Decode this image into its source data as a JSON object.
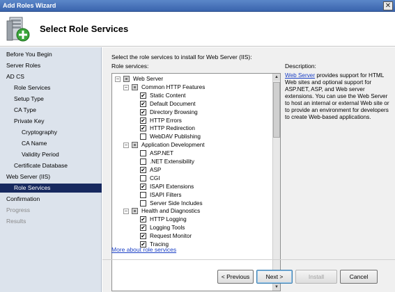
{
  "window": {
    "title": "Add Roles Wizard",
    "close_glyph": "✕"
  },
  "header": {
    "title": "Select Role Services",
    "icon": "server-add-icon"
  },
  "sidebar": {
    "items": [
      {
        "label": "Before You Begin",
        "level": 0,
        "state": "normal"
      },
      {
        "label": "Server Roles",
        "level": 0,
        "state": "normal"
      },
      {
        "label": "AD CS",
        "level": 0,
        "state": "normal"
      },
      {
        "label": "Role Services",
        "level": 1,
        "state": "normal"
      },
      {
        "label": "Setup Type",
        "level": 1,
        "state": "normal"
      },
      {
        "label": "CA Type",
        "level": 1,
        "state": "normal"
      },
      {
        "label": "Private Key",
        "level": 1,
        "state": "normal"
      },
      {
        "label": "Cryptography",
        "level": 2,
        "state": "normal"
      },
      {
        "label": "CA Name",
        "level": 2,
        "state": "normal"
      },
      {
        "label": "Validity Period",
        "level": 2,
        "state": "normal"
      },
      {
        "label": "Certificate Database",
        "level": 1,
        "state": "normal"
      },
      {
        "label": "Web Server (IIS)",
        "level": 0,
        "state": "normal"
      },
      {
        "label": "Role Services",
        "level": 1,
        "state": "selected"
      },
      {
        "label": "Confirmation",
        "level": 0,
        "state": "normal"
      },
      {
        "label": "Progress",
        "level": 0,
        "state": "disabled"
      },
      {
        "label": "Results",
        "level": 0,
        "state": "disabled"
      }
    ]
  },
  "main": {
    "instruction": "Select the role services to install for Web Server (IIS):",
    "role_services_label": "Role services:",
    "description_label": "Description:",
    "description_link": "Web Server",
    "description_text": " provides support for HTML Web sites and optional support for ASP.NET, ASP, and Web server extensions. You can use the Web Server to host an internal or external Web site or to provide an environment for developers to create Web-based applications.",
    "more_link": "More about role services",
    "tree": [
      {
        "label": "Web Server",
        "level": 0,
        "expander": "−",
        "check": "partial"
      },
      {
        "label": "Common HTTP Features",
        "level": 1,
        "expander": "−",
        "check": "partial"
      },
      {
        "label": "Static Content",
        "level": 2,
        "check": "checked"
      },
      {
        "label": "Default Document",
        "level": 2,
        "check": "checked"
      },
      {
        "label": "Directory Browsing",
        "level": 2,
        "check": "checked"
      },
      {
        "label": "HTTP Errors",
        "level": 2,
        "check": "checked"
      },
      {
        "label": "HTTP Redirection",
        "level": 2,
        "check": "checked"
      },
      {
        "label": "WebDAV Publishing",
        "level": 2,
        "check": "unchecked"
      },
      {
        "label": "Application Development",
        "level": 1,
        "expander": "−",
        "check": "partial"
      },
      {
        "label": "ASP.NET",
        "level": 2,
        "check": "unchecked"
      },
      {
        "label": ".NET Extensibility",
        "level": 2,
        "check": "unchecked"
      },
      {
        "label": "ASP",
        "level": 2,
        "check": "checked"
      },
      {
        "label": "CGI",
        "level": 2,
        "check": "unchecked"
      },
      {
        "label": "ISAPI Extensions",
        "level": 2,
        "check": "checked"
      },
      {
        "label": "ISAPI Filters",
        "level": 2,
        "check": "unchecked"
      },
      {
        "label": "Server Side Includes",
        "level": 2,
        "check": "unchecked"
      },
      {
        "label": "Health and Diagnostics",
        "level": 1,
        "expander": "−",
        "check": "partial"
      },
      {
        "label": "HTTP Logging",
        "level": 2,
        "check": "checked"
      },
      {
        "label": "Logging Tools",
        "level": 2,
        "check": "checked"
      },
      {
        "label": "Request Monitor",
        "level": 2,
        "check": "checked"
      },
      {
        "label": "Tracing",
        "level": 2,
        "check": "checked"
      }
    ],
    "check_glyph": "✔"
  },
  "buttons": {
    "previous": "< Previous",
    "next": "Next >",
    "install": "Install",
    "cancel": "Cancel"
  }
}
